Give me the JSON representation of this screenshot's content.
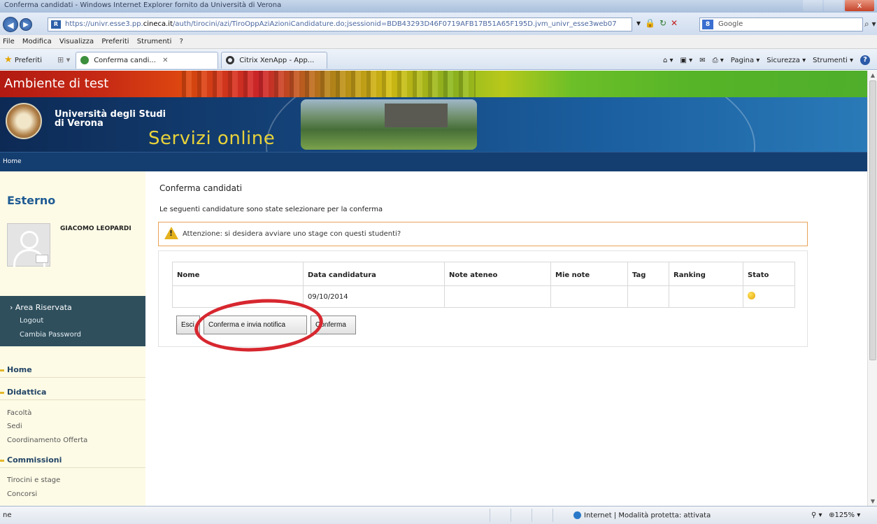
{
  "browser": {
    "window_title": "Conferma candidati - Windows Internet Explorer fornito da Università di Verona",
    "url_pre": "https://univr.esse3.pp.",
    "url_host": "cineca.it",
    "url_post": "/auth/tirocini/azi/TiroOppAziAzioniCandidature.do;jsessionid=BDB43293D46F0719AFB17B51A65F195D.jvm_univr_esse3web07",
    "search_placeholder": "Google",
    "menu": [
      "File",
      "Modifica",
      "Visualizza",
      "Preferiti",
      "Strumenti",
      "?"
    ],
    "favorites_label": "Preferiti",
    "tabs": [
      {
        "label": "Conferma candi...",
        "active": true
      },
      {
        "label": "Citrix XenApp - App...",
        "active": false
      }
    ],
    "command_bar": [
      "Pagina ▾",
      "Sicurezza ▾",
      "Strumenti ▾"
    ],
    "status_left": "ne",
    "status_zone": "Internet | Modalità protetta: attivata",
    "zoom": "125%"
  },
  "site": {
    "test_banner": "Ambiente di test",
    "university_line1": "Università degli Studi",
    "university_line2": "di Verona",
    "servizi": "Servizi online",
    "home_link": "Home"
  },
  "sidebar": {
    "profile_type": "Esterno",
    "user_name": "GIACOMO LEOPARDI",
    "area_riservata": "Area Riservata",
    "area_links": [
      "Logout",
      "Cambia Password"
    ],
    "sections": [
      {
        "title": "Home",
        "items": []
      },
      {
        "title": "Didattica",
        "items": [
          "Facoltà",
          "Sedi",
          "Coordinamento Offerta"
        ]
      },
      {
        "title": "Commissioni",
        "items": [
          "Tirocini e stage",
          "Concorsi"
        ]
      }
    ]
  },
  "main": {
    "title": "Conferma candidati",
    "subtitle": "Le seguenti candidature sono state selezionare per la conferma",
    "warning": "Attenzione: si desidera avviare uno stage con questi studenti?",
    "table": {
      "headers": [
        "Nome",
        "Data candidatura",
        "Note ateneo",
        "Mie note",
        "Tag",
        "Ranking",
        "Stato"
      ],
      "rows": [
        {
          "nome": "",
          "data": "09/10/2014",
          "note_ateneo": "",
          "mie_note": "",
          "tag": "",
          "ranking": "",
          "stato": "yellow-dot"
        }
      ]
    },
    "buttons": {
      "esci": "Esci",
      "conferma_invia": "Conferma e invia notifica",
      "conferma": "Conferma"
    },
    "highlight_color": "#d7272f"
  }
}
